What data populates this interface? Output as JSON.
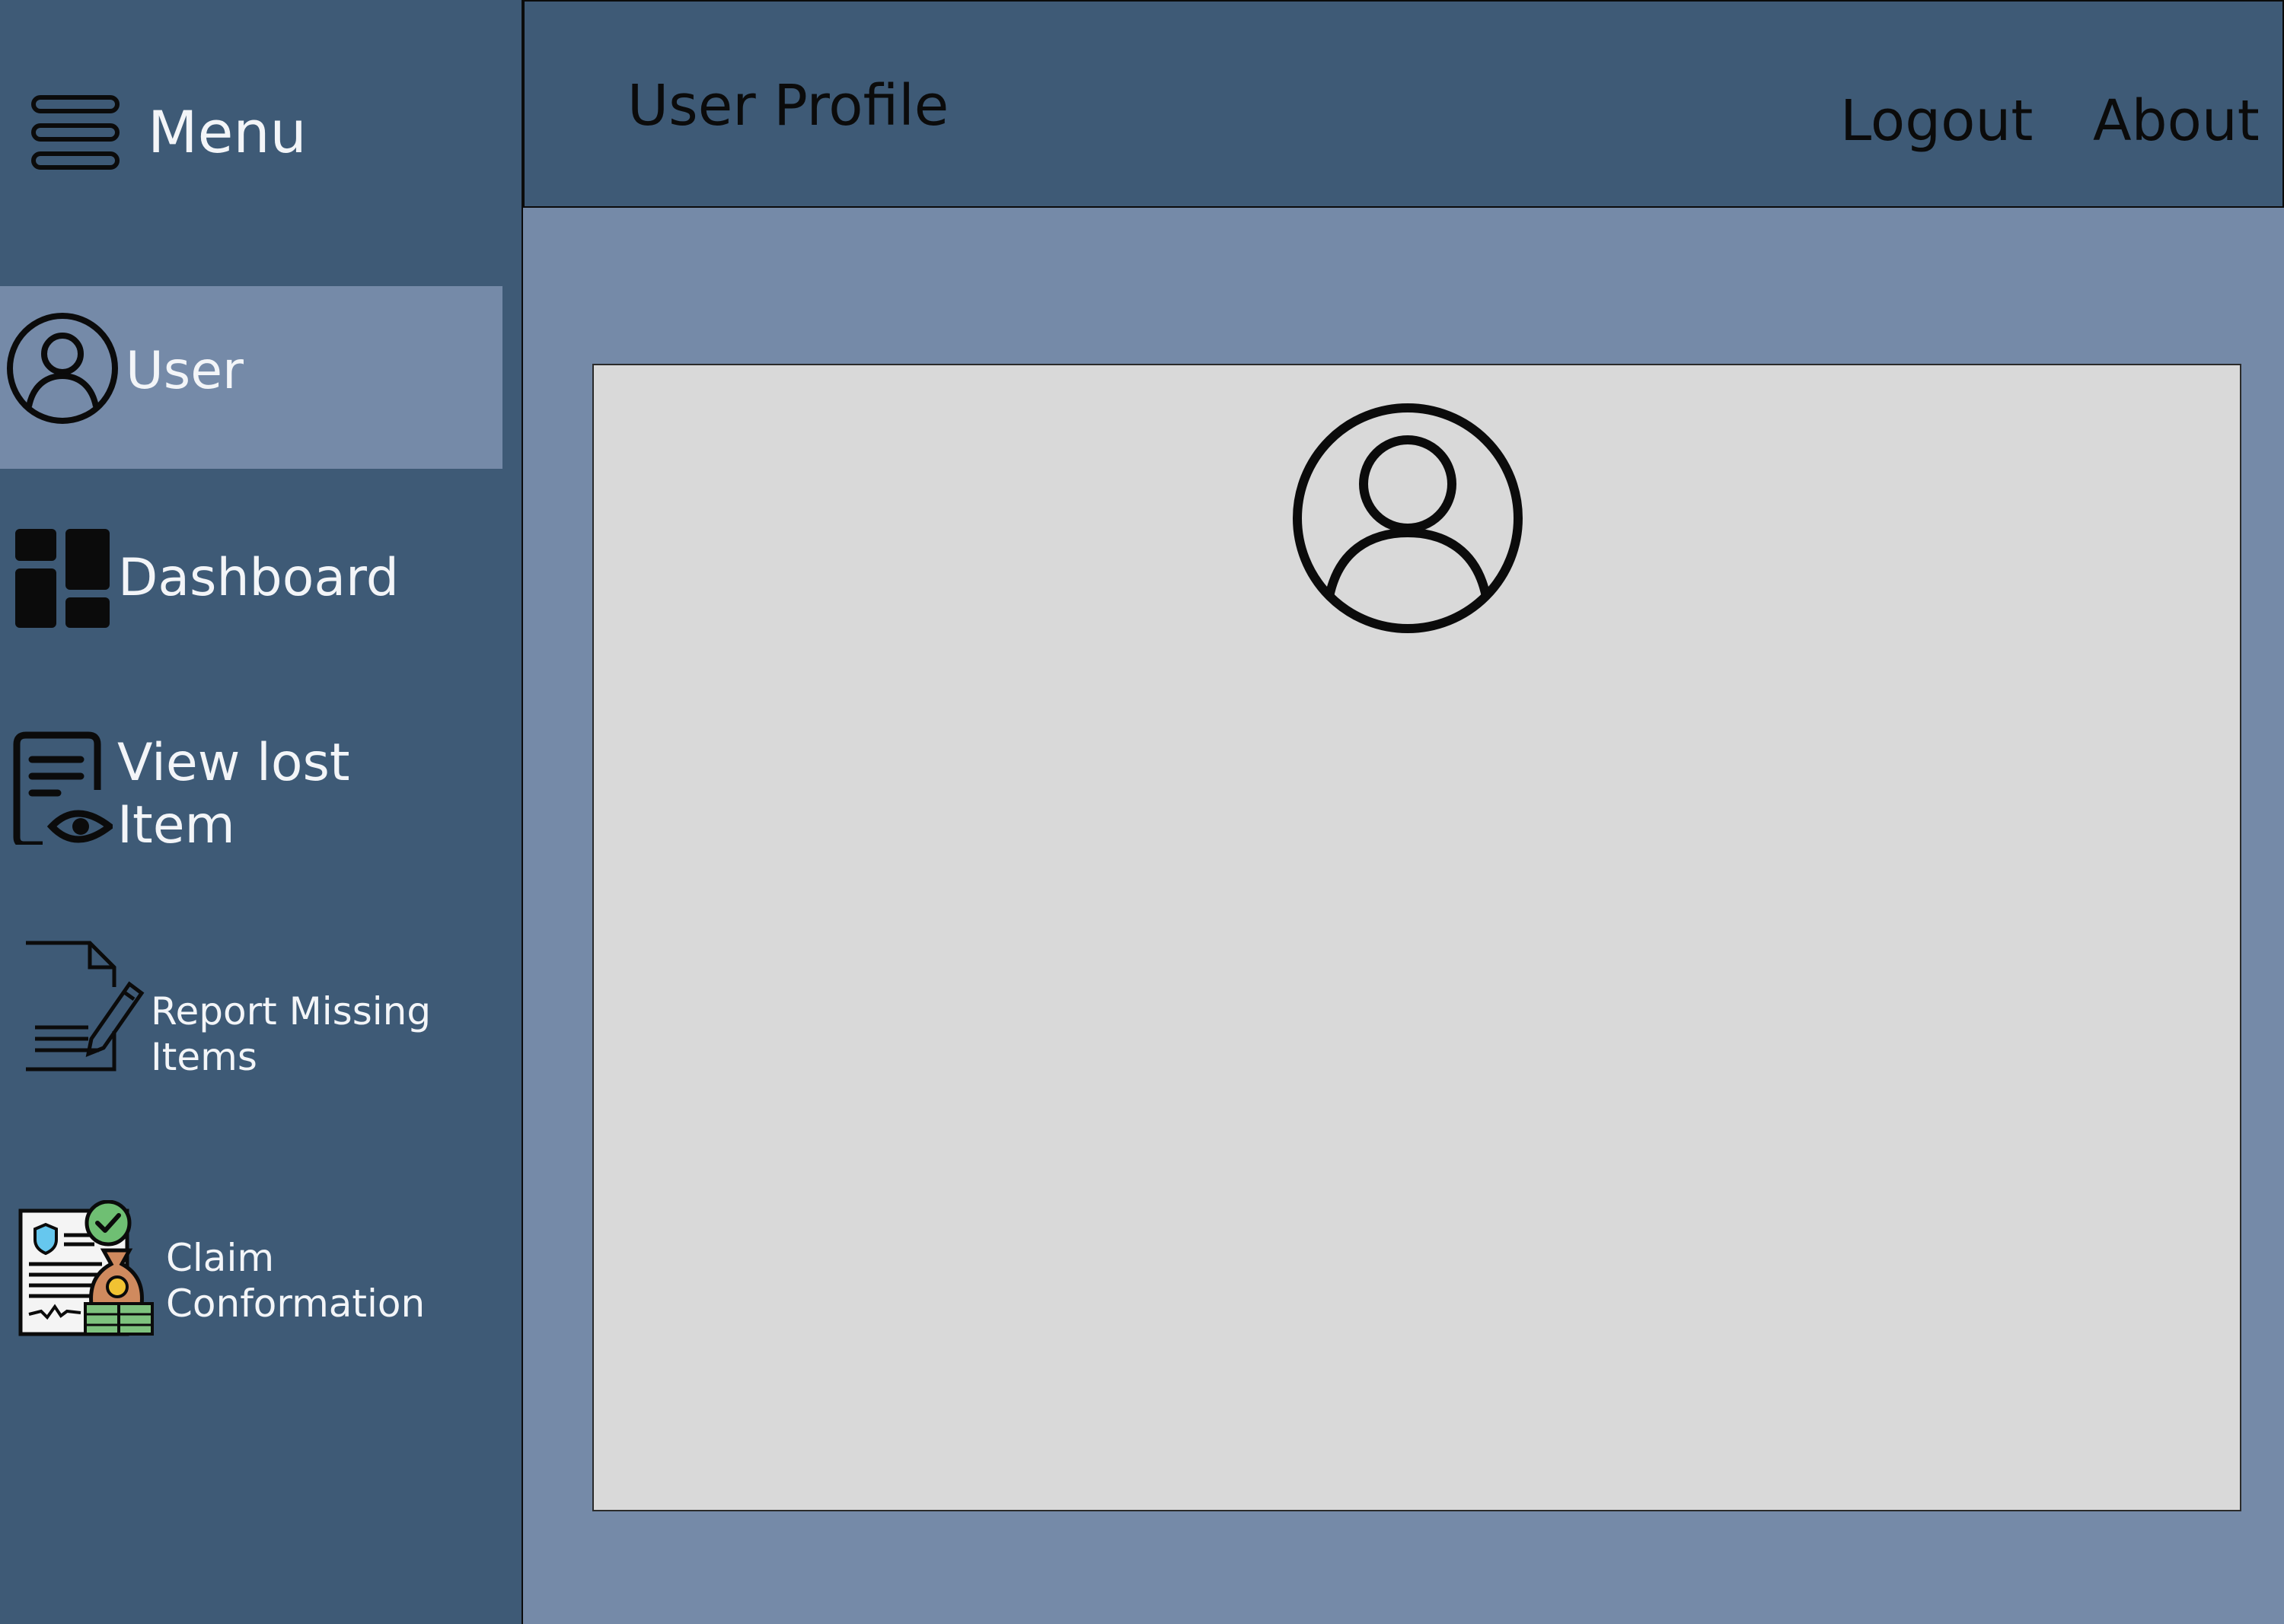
{
  "sidebar": {
    "menu_label": "Menu",
    "menu_icon": "hamburger-menu-icon",
    "items": [
      {
        "label": "User",
        "icon": "user-circle-icon",
        "active": true
      },
      {
        "label": "Dashboard",
        "icon": "dashboard-grid-icon",
        "active": false
      },
      {
        "label_line1": "View lost",
        "label_line2": "Item",
        "icon": "document-eye-icon",
        "active": false
      },
      {
        "label_line1": "Report Missing",
        "label_line2": "Items",
        "icon": "document-pen-icon",
        "active": false
      },
      {
        "label_line1": "Claim",
        "label_line2": "Conformation",
        "icon": "insurance-claim-icon",
        "active": false
      }
    ]
  },
  "header": {
    "title": "User Profile",
    "links": [
      "Logout",
      "About"
    ]
  },
  "main": {
    "avatar_icon": "user-circle-icon"
  },
  "colors": {
    "sidebar_bg": "#3e5a76",
    "header_bg": "#3e5a76",
    "page_bg": "#758aa8",
    "active_item_bg": "#758aa8",
    "panel_bg": "#d9d9d9",
    "text_light": "#f3f5f8",
    "text_dark": "#0b0b0b"
  }
}
